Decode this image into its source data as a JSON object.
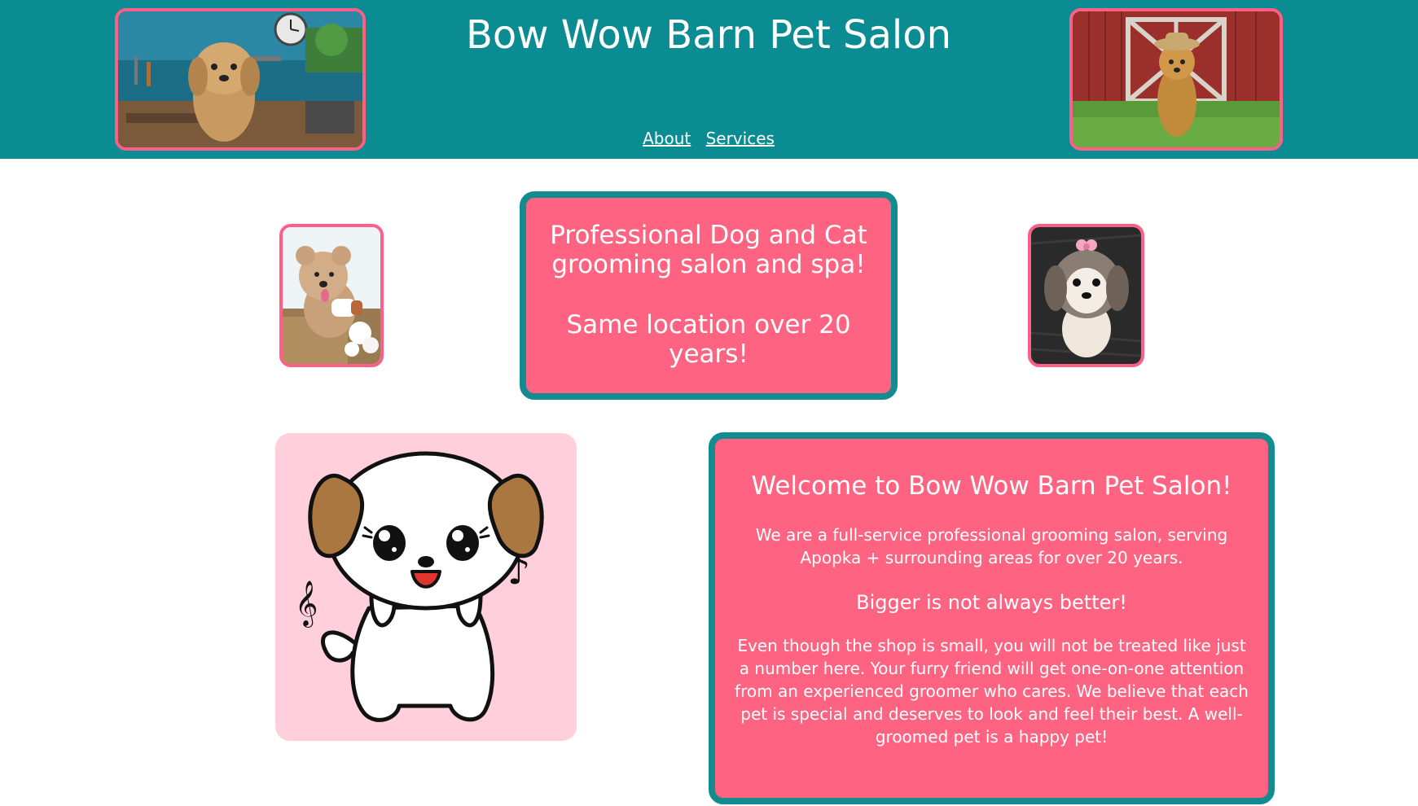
{
  "header": {
    "title": "Bow Wow Barn Pet Salon",
    "nav": [
      "About",
      "Services"
    ]
  },
  "tagline": {
    "line1": "Professional Dog and Cat grooming salon and spa!",
    "line2": "Same location over 20 years!"
  },
  "welcome": {
    "heading": "Welcome to Bow Wow Barn Pet Salon!",
    "intro": "We are a full-service professional grooming salon, serving Apopka + surrounding areas for over 20 years.",
    "subheading": "Bigger is not always better!",
    "body": "Even though the shop is small, you will not be treated like just a number here. Your furry friend will get one-on-one attention from an experienced groomer who cares. We believe that each pet is special and deserves to look and feel their best. A well-groomed pet is a happy pet!"
  },
  "colors": {
    "teal": "#0a8c92",
    "pink": "#ff6382",
    "border_pink": "#ff5f87",
    "cartoon_bg": "#ffd0dc"
  }
}
